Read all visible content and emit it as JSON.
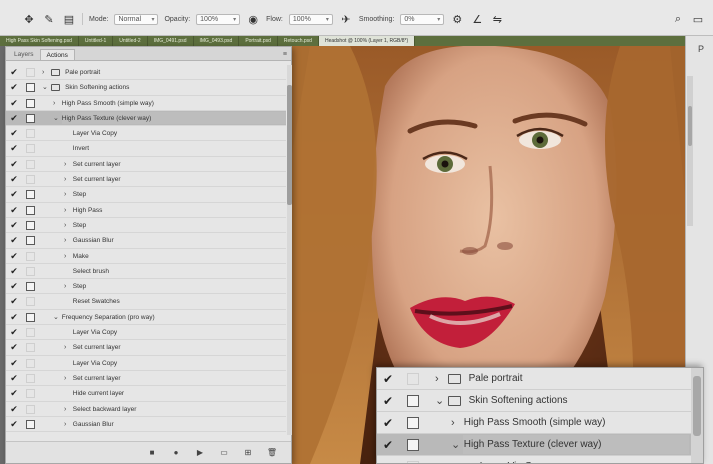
{
  "options_bar": {
    "tools": [
      "move-tool-icon",
      "brush-tool-icon",
      "toggle-panel-icon"
    ],
    "mode_label": "Mode:",
    "mode_value": "Normal",
    "opacity_label": "Opacity:",
    "opacity_value": "100%",
    "flow_label": "Flow:",
    "flow_value": "100%",
    "smoothing_label": "Smoothing:",
    "smoothing_value": "0%",
    "right_icons": [
      "search-icon",
      "workspace-icon"
    ]
  },
  "doc_tabs": [
    {
      "label": "High Pass Skin Softening.psd",
      "active": false
    },
    {
      "label": "Untitled-1",
      "active": false
    },
    {
      "label": "Untitled-2",
      "active": false
    },
    {
      "label": "IMG_0491.psd",
      "active": false
    },
    {
      "label": "IMG_0493.psd",
      "active": false
    },
    {
      "label": "Portrait.psd",
      "active": false
    },
    {
      "label": "Retouch.psd",
      "active": false
    },
    {
      "label": "Headshot @ 100% (Layer 1, RGB/8*)",
      "active": true
    }
  ],
  "panel": {
    "tabs": [
      "Layers",
      "Actions"
    ],
    "active_tab": "Actions",
    "rows": [
      {
        "check": true,
        "dialog": false,
        "level": 0,
        "chev": "›",
        "folder": true,
        "label": "Pale portrait"
      },
      {
        "check": true,
        "dialog": true,
        "level": 0,
        "chev": "⌄",
        "folder": true,
        "label": "Skin Softening actions"
      },
      {
        "check": true,
        "dialog": true,
        "level": 1,
        "chev": "›",
        "folder": false,
        "label": "High Pass Smooth (simple way)"
      },
      {
        "check": true,
        "dialog": true,
        "level": 1,
        "chev": "⌄",
        "folder": false,
        "label": "High Pass Texture (clever way)",
        "selected": true
      },
      {
        "check": true,
        "dialog": false,
        "level": 2,
        "chev": "",
        "folder": false,
        "label": "Layer Via Copy"
      },
      {
        "check": true,
        "dialog": false,
        "level": 2,
        "chev": "",
        "folder": false,
        "label": "Invert"
      },
      {
        "check": true,
        "dialog": false,
        "level": 2,
        "chev": "›",
        "folder": false,
        "label": "Set current layer"
      },
      {
        "check": true,
        "dialog": false,
        "level": 2,
        "chev": "›",
        "folder": false,
        "label": "Set current layer"
      },
      {
        "check": true,
        "dialog": true,
        "level": 2,
        "chev": "›",
        "folder": false,
        "label": "Step"
      },
      {
        "check": true,
        "dialog": true,
        "level": 2,
        "chev": "›",
        "folder": false,
        "label": "High Pass"
      },
      {
        "check": true,
        "dialog": true,
        "level": 2,
        "chev": "›",
        "folder": false,
        "label": "Step"
      },
      {
        "check": true,
        "dialog": true,
        "level": 2,
        "chev": "›",
        "folder": false,
        "label": "Gaussian Blur"
      },
      {
        "check": true,
        "dialog": false,
        "level": 2,
        "chev": "›",
        "folder": false,
        "label": "Make"
      },
      {
        "check": true,
        "dialog": false,
        "level": 2,
        "chev": "",
        "folder": false,
        "label": "Select brush"
      },
      {
        "check": true,
        "dialog": true,
        "level": 2,
        "chev": "›",
        "folder": false,
        "label": "Step"
      },
      {
        "check": true,
        "dialog": false,
        "level": 2,
        "chev": "",
        "folder": false,
        "label": "Reset Swatches"
      },
      {
        "check": true,
        "dialog": true,
        "level": 1,
        "chev": "⌄",
        "folder": false,
        "label": "Frequency Separation (pro way)"
      },
      {
        "check": true,
        "dialog": false,
        "level": 2,
        "chev": "",
        "folder": false,
        "label": "Layer Via Copy"
      },
      {
        "check": true,
        "dialog": false,
        "level": 2,
        "chev": "›",
        "folder": false,
        "label": "Set current layer"
      },
      {
        "check": true,
        "dialog": false,
        "level": 2,
        "chev": "",
        "folder": false,
        "label": "Layer Via Copy"
      },
      {
        "check": true,
        "dialog": false,
        "level": 2,
        "chev": "›",
        "folder": false,
        "label": "Set current layer"
      },
      {
        "check": true,
        "dialog": false,
        "level": 2,
        "chev": "",
        "folder": false,
        "label": "Hide current layer"
      },
      {
        "check": true,
        "dialog": false,
        "level": 2,
        "chev": "›",
        "folder": false,
        "label": "Select backward layer"
      },
      {
        "check": true,
        "dialog": true,
        "level": 2,
        "chev": "›",
        "folder": false,
        "label": "Gaussian Blur"
      }
    ],
    "bottom_buttons": [
      "stop-icon",
      "record-icon",
      "play-icon",
      "new-set-icon",
      "new-action-icon",
      "delete-icon"
    ]
  },
  "inset": {
    "rows": [
      {
        "check": true,
        "dialog": false,
        "level": 0,
        "chev": "›",
        "folder": true,
        "label": "Pale portrait"
      },
      {
        "check": true,
        "dialog": true,
        "level": 0,
        "chev": "⌄",
        "folder": true,
        "label": "Skin Softening actions"
      },
      {
        "check": true,
        "dialog": true,
        "level": 1,
        "chev": "›",
        "folder": false,
        "label": "High Pass Smooth (simple way)"
      },
      {
        "check": true,
        "dialog": true,
        "level": 1,
        "chev": "⌄",
        "folder": false,
        "label": "High Pass Texture (clever way)",
        "selected": true
      },
      {
        "check": true,
        "dialog": false,
        "level": 2,
        "chev": "",
        "folder": false,
        "label": "Layer Via Copy"
      }
    ]
  },
  "right_strip": {
    "label": "P"
  }
}
